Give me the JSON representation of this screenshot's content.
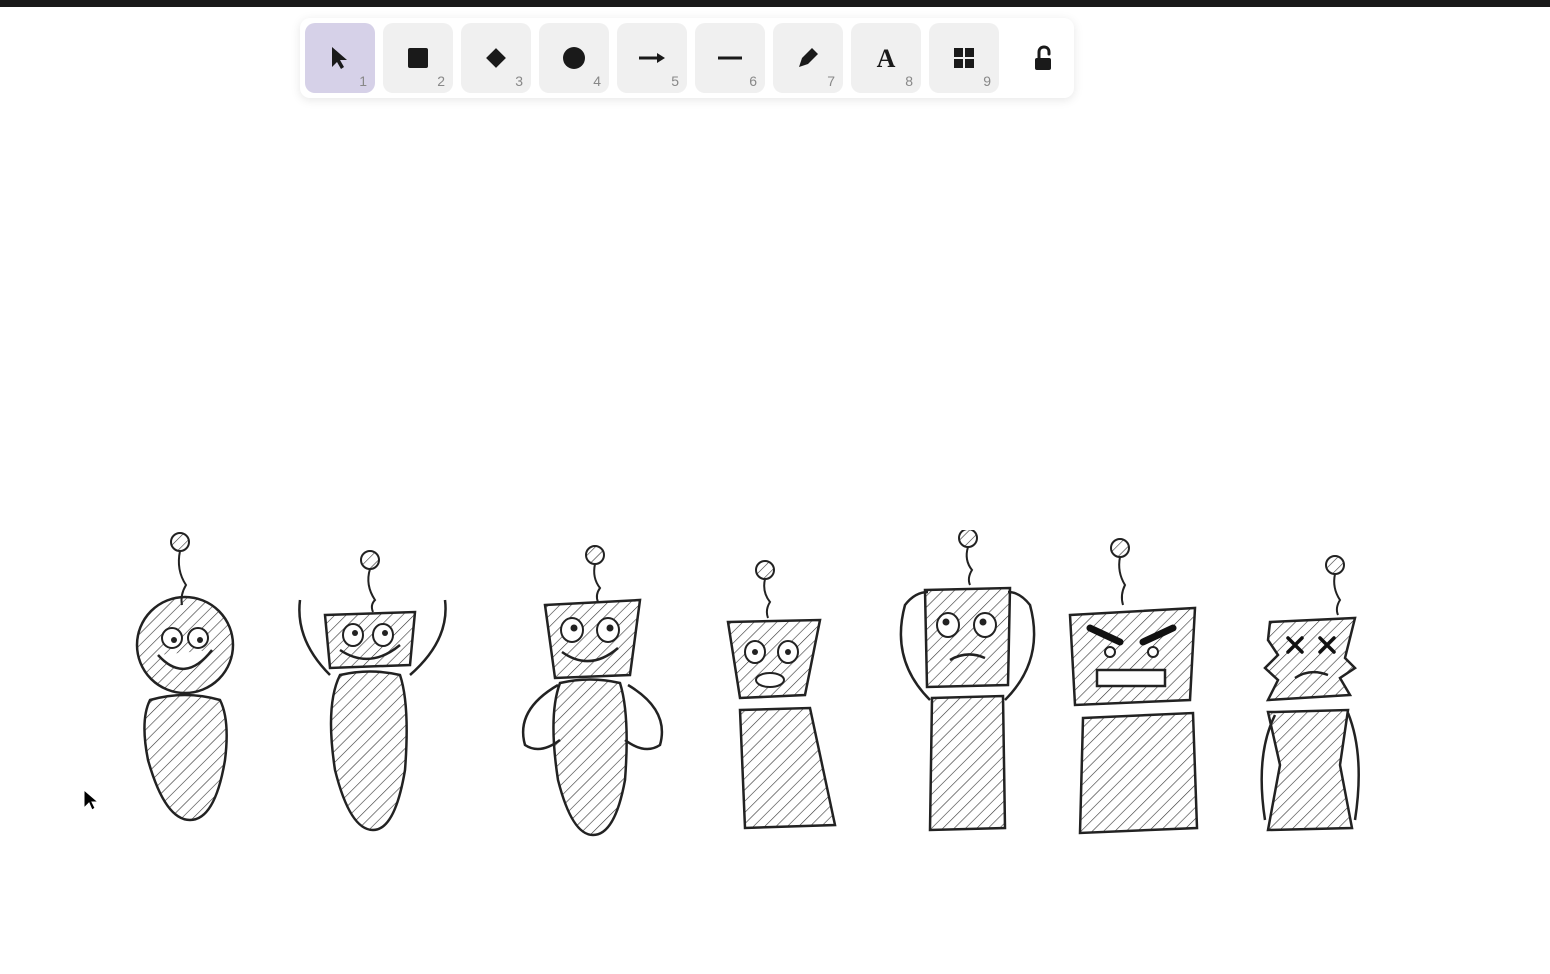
{
  "toolbar": {
    "tools": [
      {
        "name": "selection",
        "shortcut": "1",
        "active": true
      },
      {
        "name": "rectangle",
        "shortcut": "2",
        "active": false
      },
      {
        "name": "diamond",
        "shortcut": "3",
        "active": false
      },
      {
        "name": "ellipse",
        "shortcut": "4",
        "active": false
      },
      {
        "name": "arrow",
        "shortcut": "5",
        "active": false
      },
      {
        "name": "line",
        "shortcut": "6",
        "active": false
      },
      {
        "name": "draw",
        "shortcut": "7",
        "active": false
      },
      {
        "name": "text",
        "shortcut": "8",
        "active": false
      },
      {
        "name": "more-shapes",
        "shortcut": "9",
        "active": false
      }
    ],
    "lock": {
      "locked": false
    }
  },
  "canvas": {
    "drawings": [
      {
        "type": "robot-sketch",
        "expression": "happy-round",
        "index": 0
      },
      {
        "type": "robot-sketch",
        "expression": "joyful-arms-up",
        "index": 1
      },
      {
        "type": "robot-sketch",
        "expression": "smiling-hands-hips",
        "index": 2
      },
      {
        "type": "robot-sketch",
        "expression": "surprised",
        "index": 3
      },
      {
        "type": "robot-sketch",
        "expression": "worried-hands-head",
        "index": 4
      },
      {
        "type": "robot-sketch",
        "expression": "angry",
        "index": 5
      },
      {
        "type": "robot-sketch",
        "expression": "broken-x-eyes",
        "index": 6
      }
    ]
  }
}
